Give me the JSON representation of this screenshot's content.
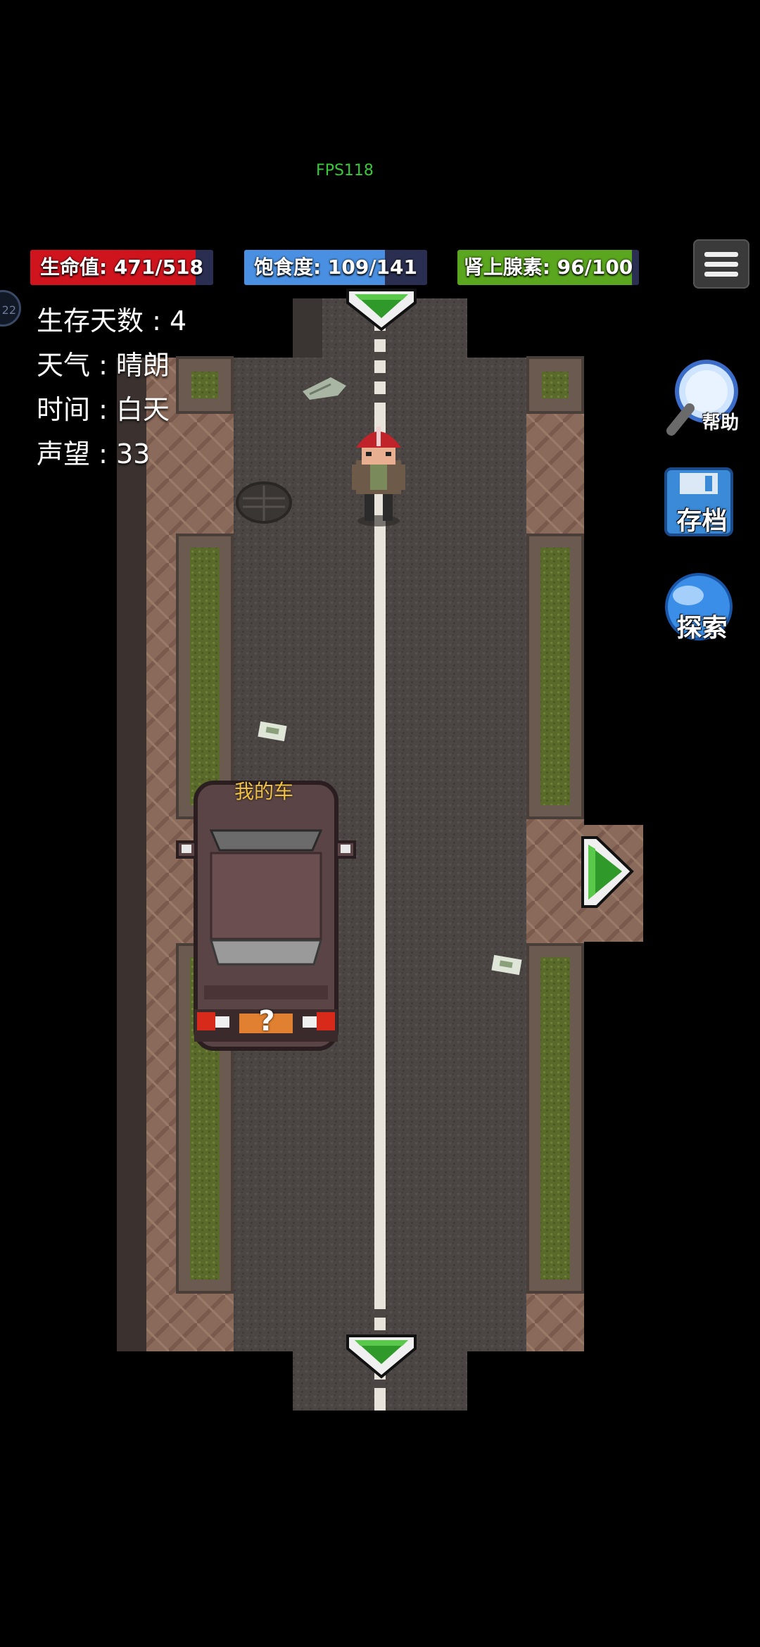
{
  "fps": "FPS118",
  "bars": {
    "health": {
      "label": "生命值: 471/518",
      "current": 471,
      "max": 518,
      "color": "#d0141e"
    },
    "satiety": {
      "label": "饱食度: 109/141",
      "current": 109,
      "max": 141,
      "color": "#4a90e2"
    },
    "adrenaline": {
      "label": "肾上腺素: 96/100",
      "current": 96,
      "max": 100,
      "color": "#5aa61e"
    }
  },
  "stats": {
    "days": "生存天数 : 4",
    "weather": "天气 : 晴朗",
    "time": "时间 : 白天",
    "reputation": "声望 : 33"
  },
  "badge": "22",
  "buttons": {
    "help": "帮助",
    "save": "存档",
    "explore": "探索"
  },
  "car": {
    "label": "我的车",
    "marker": "?"
  }
}
